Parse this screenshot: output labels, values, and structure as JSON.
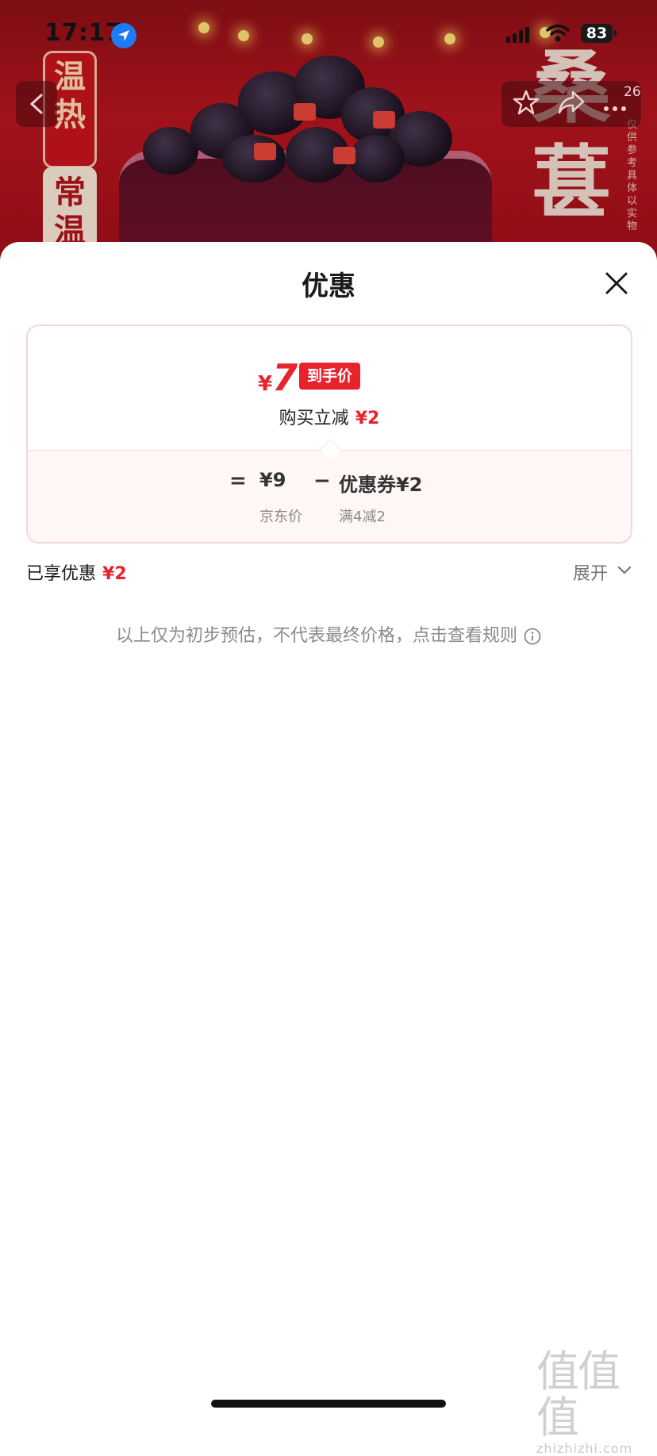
{
  "status_bar": {
    "time": "17:17",
    "battery": "83"
  },
  "hero": {
    "tag_hot": "温热",
    "tag_room": "常温",
    "big_text": "桑葚",
    "side_note": "仅供参考具体以实物",
    "badge_count": "26"
  },
  "sheet": {
    "title": "优惠",
    "final_price_currency": "¥",
    "final_price": "7",
    "final_price_tag": "到手价",
    "reduce_label": "购买立减",
    "reduce_amount": "¥2",
    "equals": "=",
    "jd_price": "¥9",
    "jd_price_label": "京东价",
    "minus": "−",
    "coupon": "优惠券¥2",
    "coupon_rule": "满4减2",
    "enjoyed_label": "已享优惠",
    "enjoyed_amount": "¥2",
    "expand_label": "展开",
    "disclaimer": "以上仅为初步预估，不代表最终价格，点击查看规则"
  },
  "watermark": {
    "main": "值值值",
    "sub": "zhizhizhi.com"
  },
  "colors": {
    "accent_red": "#e8232d",
    "hero_red": "#b8151f"
  }
}
